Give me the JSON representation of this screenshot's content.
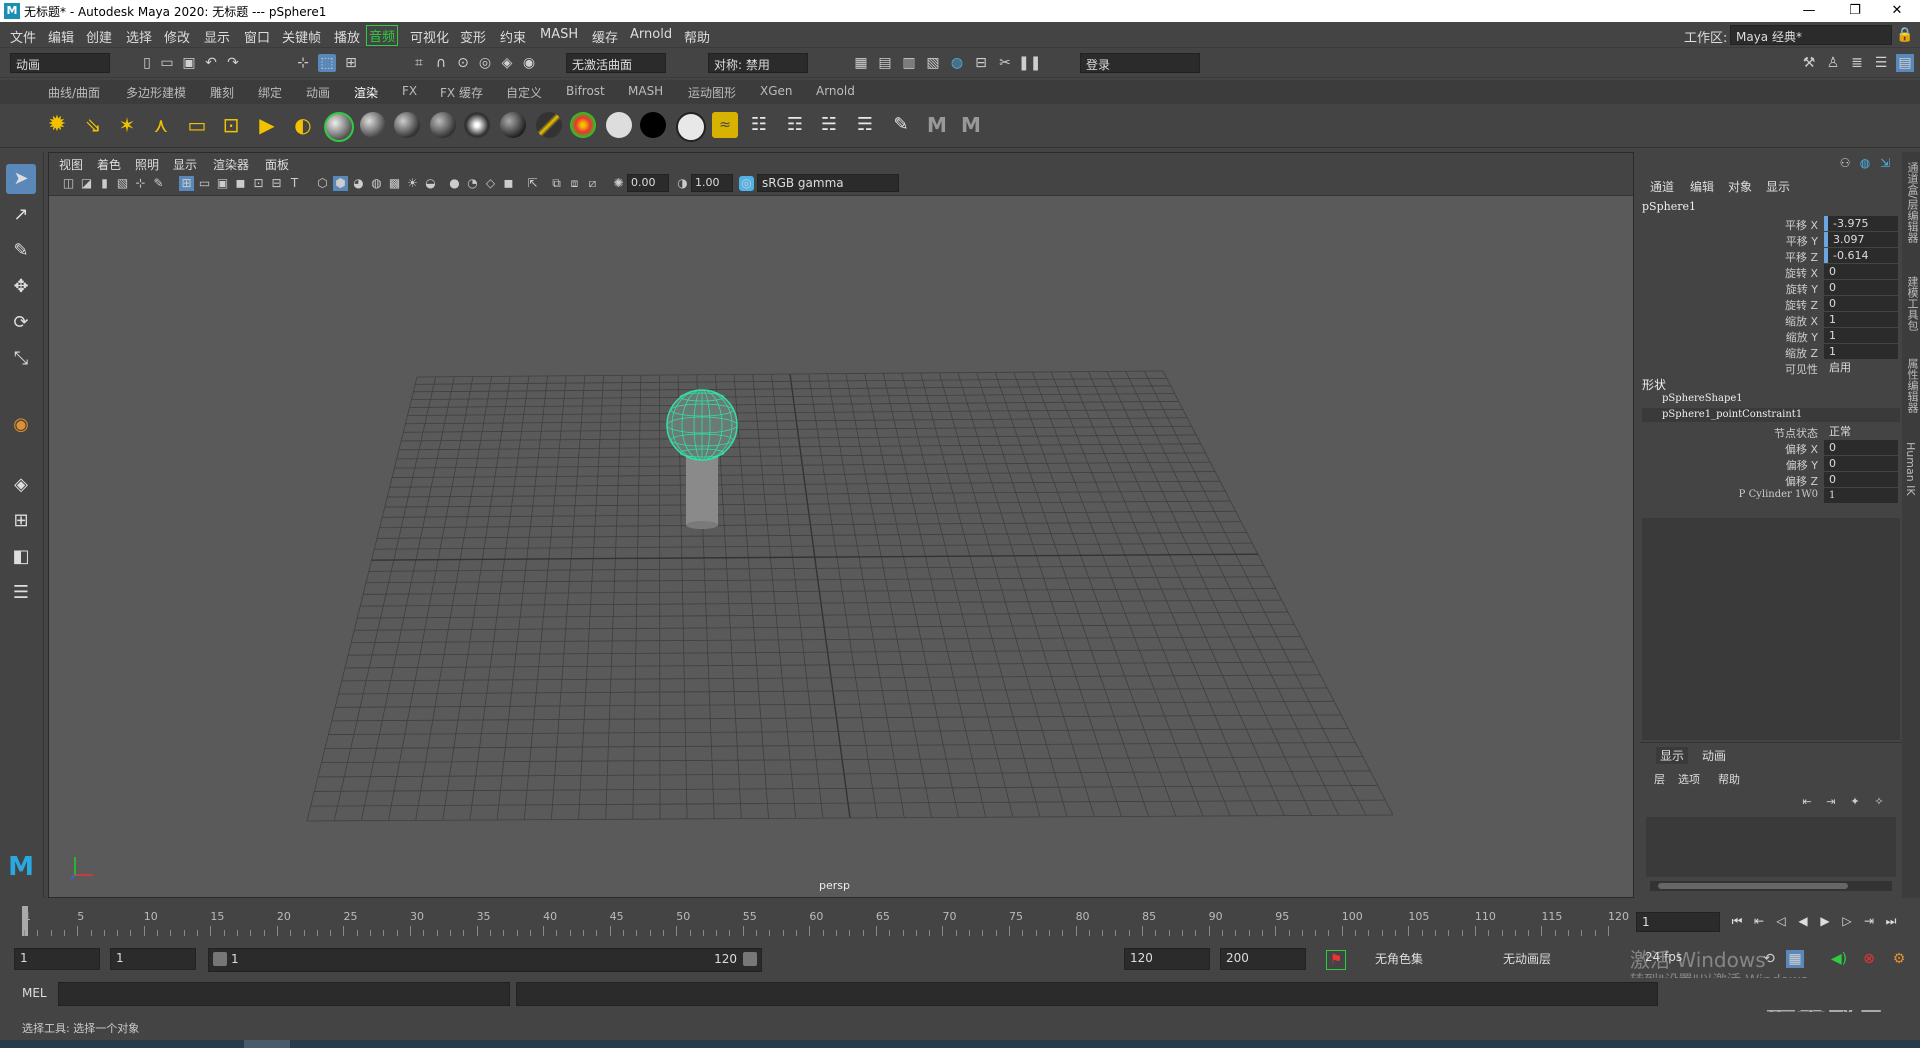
{
  "window": {
    "title": "无标题* - Autodesk Maya 2020: 无标题   ---   pSphere1",
    "logo": "M",
    "minimize": "—",
    "restore": "❐",
    "close": "✕"
  },
  "menubar": {
    "items": [
      "文件",
      "编辑",
      "创建",
      "选择",
      "修改",
      "显示",
      "窗口",
      "关键帧",
      "播放",
      "音频",
      "可视化",
      "变形",
      "约束",
      "MASH",
      "缓存",
      "Arnold",
      "帮助"
    ],
    "highlighted": "音频",
    "workspace_label": "工作区:",
    "workspace_value": "Maya 经典*"
  },
  "statusline": {
    "menuset": "动画",
    "live_surface": "无激活曲面",
    "symmetry": "对称: 禁用",
    "login": "登录"
  },
  "shelf": {
    "tabs": [
      "曲线/曲面",
      "多边形建模",
      "雕刻",
      "绑定",
      "动画",
      "渲染",
      "FX",
      "FX 缓存",
      "自定义",
      "Bifrost",
      "MASH",
      "运动图形",
      "XGen",
      "Arnold"
    ],
    "active_tab": "渲染"
  },
  "viewport": {
    "menus": [
      "视图",
      "着色",
      "照明",
      "显示",
      "渲染器",
      "面板"
    ],
    "exposure": "0.00",
    "gamma": "1.00",
    "color_space": "sRGB gamma",
    "camera": "persp",
    "colors": {
      "background": "#5a5a5a",
      "grid": "#3f3f3f",
      "sphere_wire": "#31e0a8",
      "cylinder": "#8a8a8a"
    }
  },
  "channelbox": {
    "menus": [
      "通道",
      "编辑",
      "对象",
      "显示"
    ],
    "object": "pSphere1",
    "attributes": [
      {
        "label": "平移 X",
        "value": "-3.975"
      },
      {
        "label": "平移 Y",
        "value": "3.097"
      },
      {
        "label": "平移 Z",
        "value": "-0.614"
      },
      {
        "label": "旋转 X",
        "value": "0"
      },
      {
        "label": "旋转 Y",
        "value": "0"
      },
      {
        "label": "旋转 Z",
        "value": "0"
      },
      {
        "label": "缩放 X",
        "value": "1"
      },
      {
        "label": "缩放 Y",
        "value": "1"
      },
      {
        "label": "缩放 Z",
        "value": "1"
      },
      {
        "label": "可见性",
        "value": "启用"
      }
    ],
    "shapes_header": "形状",
    "shape_nodes": [
      "pSphereShape1",
      "pSphere1_pointConstraint1"
    ],
    "constraint_attributes": [
      {
        "label": "节点状态",
        "value": "正常"
      },
      {
        "label": "偏移 X",
        "value": "0"
      },
      {
        "label": "偏移 Y",
        "value": "0"
      },
      {
        "label": "偏移 Z",
        "value": "0"
      },
      {
        "label": "P Cylinder 1W0",
        "value": "1"
      }
    ]
  },
  "layereditor": {
    "tabs": [
      "显示",
      "动画"
    ],
    "menus": [
      "层",
      "选项",
      "帮助"
    ]
  },
  "sidestrip": {
    "labels": [
      "通道盒/层编辑器",
      "建模工具包",
      "属性编辑器",
      "Human IK"
    ]
  },
  "timeline": {
    "ticks": [
      "1",
      "5",
      "10",
      "15",
      "20",
      "25",
      "30",
      "35",
      "40",
      "45",
      "50",
      "55",
      "60",
      "65",
      "70",
      "75",
      "80",
      "85",
      "90",
      "95",
      "100",
      "105",
      "110",
      "115",
      "120"
    ],
    "current_frame": "1"
  },
  "range": {
    "start": "1",
    "playback_start": "1",
    "slider_start": "1",
    "slider_end": "120",
    "playback_end": "120",
    "end": "200",
    "character_set": "无角色集",
    "anim_layer": "无动画层",
    "fps": "24 fps"
  },
  "watermark": {
    "line1": "激活 Windows",
    "line2": "转到\"设置\"以激活 Windows。",
    "brand": "最需教育"
  },
  "cmdline": {
    "label": "MEL"
  },
  "helpline": {
    "text": "选择工具: 选择一个对象"
  }
}
